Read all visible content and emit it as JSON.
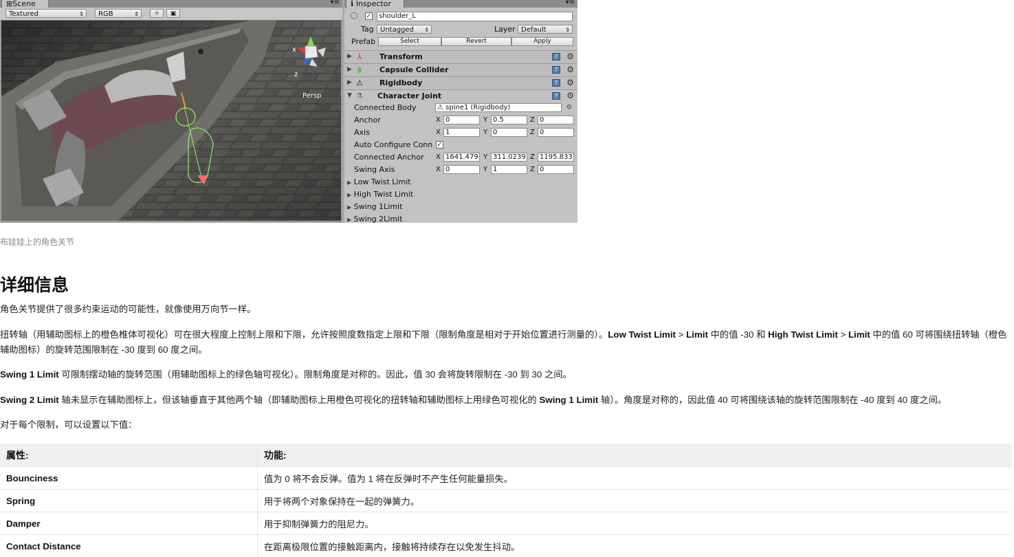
{
  "unity": {
    "scene": {
      "tab_label": "Scene",
      "render_mode": "Textured",
      "color_mode": "RGB",
      "gizmo_x": "x",
      "gizmo_z": "z",
      "persp_label": "Persp"
    },
    "inspector": {
      "tab_label": "Inspector",
      "object_name": "shoulder_L",
      "tag_label": "Tag",
      "tag_value": "Untagged",
      "layer_label": "Layer",
      "layer_value": "Default",
      "prefab_label": "Prefab",
      "prefab_select": "Select",
      "prefab_revert": "Revert",
      "prefab_apply": "Apply",
      "components": [
        "Transform",
        "Capsule Collider",
        "Rigidbody",
        "Character Joint"
      ],
      "joint": {
        "connected_body_label": "Connected Body",
        "connected_body_value": "spine1 (Rigidbody)",
        "anchor_label": "Anchor",
        "anchor": [
          "0",
          "0.5",
          "0"
        ],
        "axis_label": "Axis",
        "axis": [
          "1",
          "0",
          "0"
        ],
        "auto_configure_label": "Auto Configure Conn",
        "connected_anchor_label": "Connected Anchor",
        "connected_anchor": [
          "1641.479",
          "311.0239",
          "1195.833"
        ],
        "swing_axis_label": "Swing Axis",
        "swing_axis": [
          "0",
          "1",
          "0"
        ],
        "axis_letters": [
          "X",
          "Y",
          "Z"
        ],
        "foldouts": [
          "Low Twist Limit",
          "High Twist Limit",
          "Swing 1Limit",
          "Swing 2Limit"
        ]
      }
    }
  },
  "article": {
    "caption": "布娃娃上的角色关节",
    "heading": "详细信息",
    "p1": "角色关节提供了很多约束运动的可能性，就像使用万向节一样。",
    "p2": {
      "t1": "扭转轴（用辅助图标上的橙色椎体可视化）可在很大程度上控制上限和下限，允许按照度数指定上限和下限（限制角度是相对于开始位置进行测量的）。",
      "b1": "Low Twist Limit",
      "t2": " > ",
      "b2": "Limit",
      "t3": " 中的值 -30 和 ",
      "b3": "High Twist Limit",
      "t4": " > ",
      "b4": "Limit",
      "t5": " 中的值 60 可将围绕扭转轴（橙色辅助图标）的旋转范围限制在 -30 度到 60 度之间。"
    },
    "p3": {
      "b1": "Swing 1 Limit",
      "t1": " 可限制摆动轴的旋转范围（用辅助图标上的绿色轴可视化）。限制角度是对称的。因此，值 30 会将旋转限制在 -30 到 30 之间。"
    },
    "p4": {
      "b1": "Swing 2 Limit",
      "t1": " 轴未显示在辅助图标上，但该轴垂直于其他两个轴（即辅助图标上用橙色可视化的扭转轴和辅助图标上用绿色可视化的 ",
      "b2": "Swing 1 Limit",
      "t2": " 轴）。角度是对称的，因此值 40 可将围绕该轴的旋转范围限制在 -40 度到 40 度之间。"
    },
    "p5": "对于每个限制，可以设置以下值：",
    "table": {
      "headers": [
        "属性:",
        "功能:"
      ],
      "rows": [
        [
          "Bounciness",
          "值为 0 将不会反弹。值为 1 将在反弹时不产生任何能量损失。"
        ],
        [
          "Spring",
          "用于将两个对象保持在一起的弹簧力。"
        ],
        [
          "Damper",
          "用于抑制弹簧力的阻尼力。"
        ],
        [
          "Contact Distance",
          "在距离极限位置的接触距离内，接触将持续存在以免发生抖动。"
        ]
      ]
    }
  }
}
